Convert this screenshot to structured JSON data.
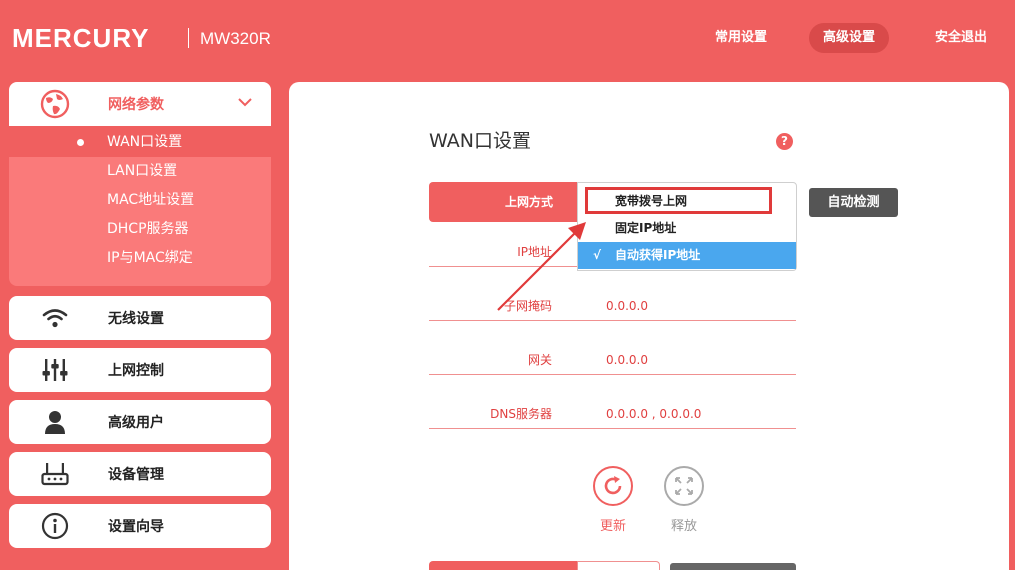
{
  "header": {
    "brand": "MERCURY",
    "model": "MW320R",
    "nav": [
      "常用设置",
      "高级设置",
      "安全退出"
    ]
  },
  "sidebar": {
    "network": {
      "label": "网络参数",
      "items": [
        "WAN口设置",
        "LAN口设置",
        "MAC地址设置",
        "DHCP服务器",
        "IP与MAC绑定"
      ]
    },
    "wireless": "无线设置",
    "access_control": "上网控制",
    "advanced_user": "高级用户",
    "device_mgmt": "设备管理",
    "wizard": "设置向导"
  },
  "main": {
    "title": "WAN口设置",
    "help": "?",
    "conn_type_label": "上网方式",
    "auto_detect": "自动检测",
    "options": [
      "宽带拨号上网",
      "固定IP地址",
      "自动获得IP地址"
    ],
    "selected_check": "√",
    "fields": [
      {
        "label": "IP地址",
        "value": ""
      },
      {
        "label": "子网掩码",
        "value": "0.0.0.0"
      },
      {
        "label": "网关",
        "value": "0.0.0.0"
      },
      {
        "label": "DNS服务器",
        "value": "0.0.0.0 , 0.0.0.0"
      }
    ],
    "renew": "更新",
    "release": "释放"
  },
  "colors": {
    "brand_red": "#f05f5f",
    "select_blue": "#4aa7ee",
    "annotation_red": "#e03a3a"
  }
}
